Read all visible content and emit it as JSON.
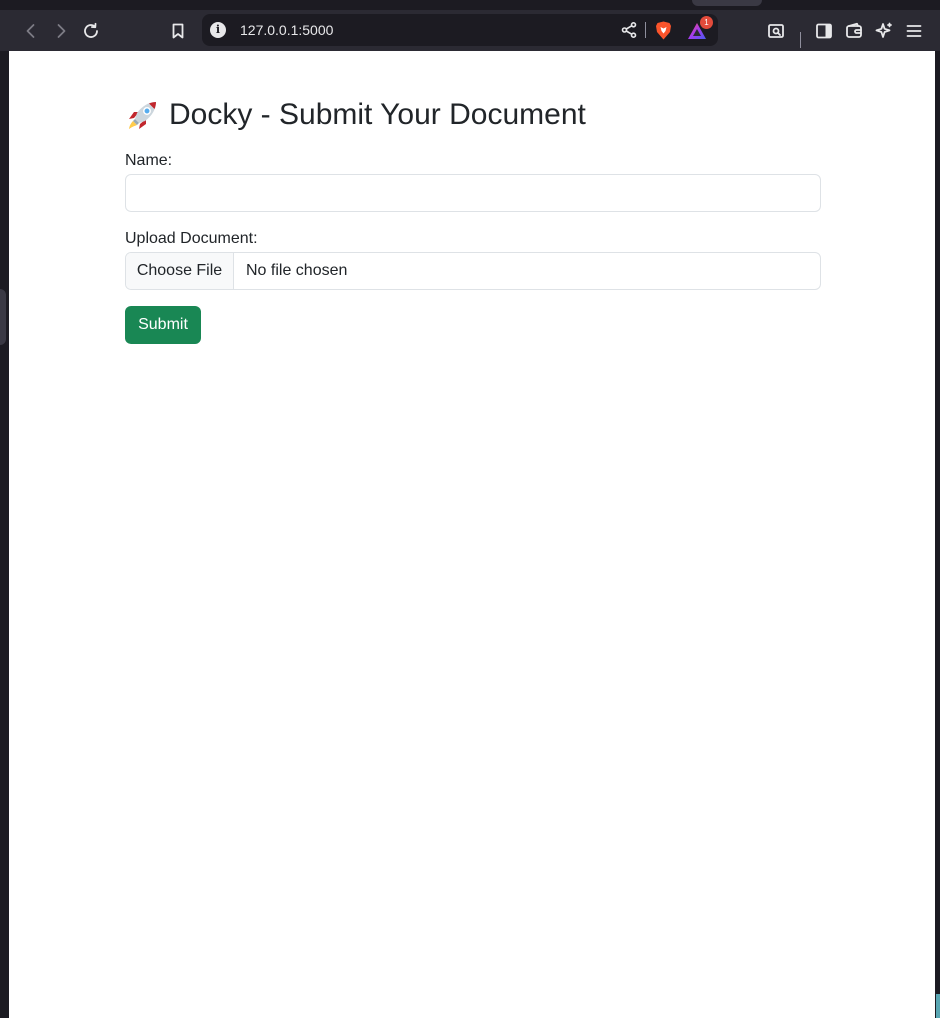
{
  "browser": {
    "url": "127.0.0.1:5000",
    "rewards_badge": "1",
    "icons": {
      "back": "arrow-left-icon",
      "forward": "arrow-right-icon",
      "reload": "reload-icon",
      "bookmark": "bookmark-icon",
      "site_info": "info-icon",
      "share": "share-icon",
      "shields": "brave-shield-icon",
      "rewards": "brave-rewards-icon",
      "screenshot": "screenshot-search-icon",
      "sidebar": "sidebar-icon",
      "wallet": "wallet-icon",
      "leo": "sparkle-icon",
      "menu": "hamburger-menu-icon"
    }
  },
  "page": {
    "title_emoji": "🚀",
    "title": "Docky - Submit Your Document",
    "name_label": "Name:",
    "name_value": "",
    "upload_label": "Upload Document:",
    "file_button": "Choose File",
    "file_status": "No file chosen",
    "submit_label": "Submit"
  },
  "colors": {
    "submit_bg": "#198754",
    "browser_toolbar": "#2b2a33",
    "browser_frame": "#1c1b22"
  }
}
